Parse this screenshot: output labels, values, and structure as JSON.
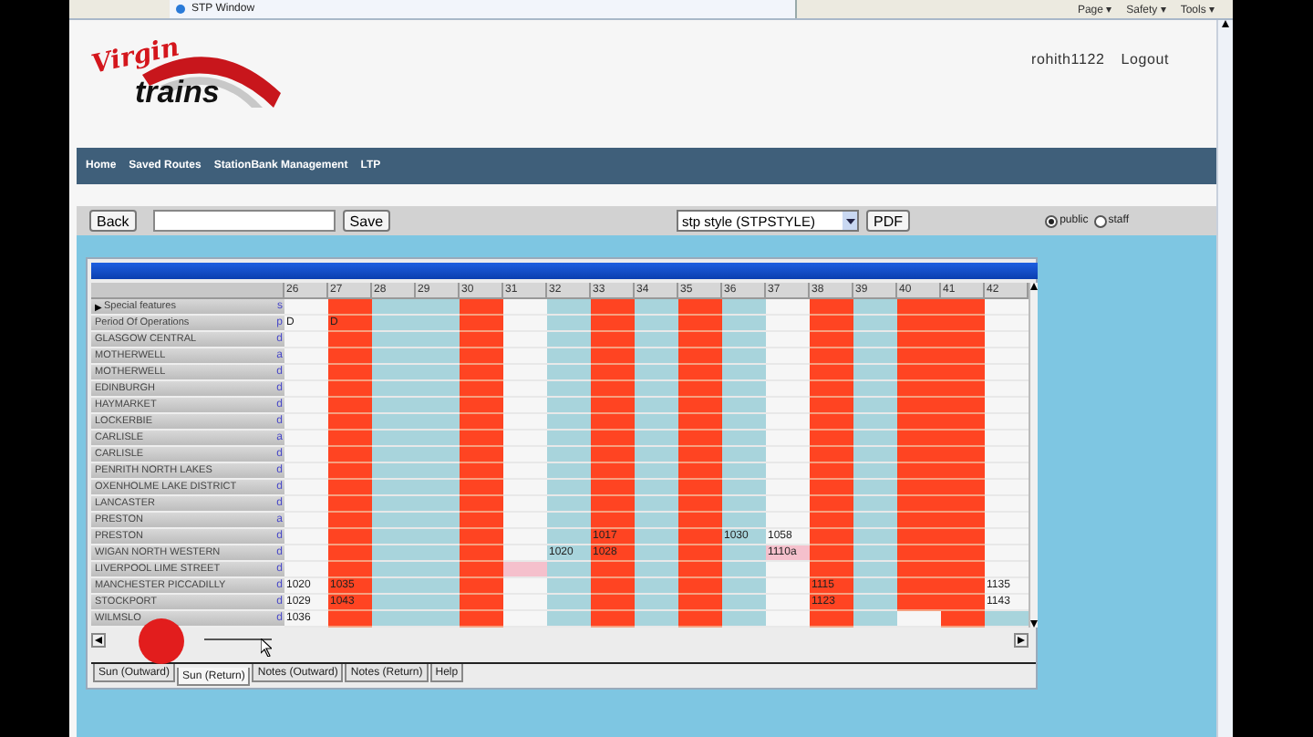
{
  "browser": {
    "tab_title": "STP Window",
    "menus": [
      "Page ▾",
      "Safety ▾",
      "Tools ▾"
    ]
  },
  "logo": {
    "line1": "Virgin",
    "line2": "trains"
  },
  "user": {
    "name": "rohith1122",
    "logout": "Logout"
  },
  "nav": [
    "Home",
    "Saved Routes",
    "StationBank Management",
    "LTP"
  ],
  "toolbar": {
    "back": "Back",
    "save": "Save",
    "style_select": "stp style (STPSTYLE)",
    "pdf": "PDF",
    "radios": [
      {
        "label": "public",
        "selected": true
      },
      {
        "label": "staff",
        "selected": false
      }
    ]
  },
  "grid": {
    "columns": [
      "26",
      "27",
      "28",
      "29",
      "30",
      "31",
      "32",
      "33",
      "34",
      "35",
      "36",
      "37",
      "38",
      "39",
      "40",
      "41",
      "42"
    ],
    "rows": [
      {
        "label": "Special features",
        "expander": "▶",
        "flag": "s",
        "cells": [
          {
            "kind": "white"
          },
          {
            "kind": "red"
          },
          {
            "kind": "blue"
          },
          {
            "kind": "blue"
          },
          {
            "kind": "red"
          },
          {
            "kind": "white"
          },
          {
            "kind": "blue"
          },
          {
            "kind": "red"
          },
          {
            "kind": "blue"
          },
          {
            "kind": "red"
          },
          {
            "kind": "blue"
          },
          {
            "kind": "white"
          },
          {
            "kind": "red"
          },
          {
            "kind": "blue"
          },
          {
            "kind": "red"
          },
          {
            "kind": "red"
          },
          {
            "kind": "white"
          }
        ]
      },
      {
        "label": "Period Of Operations",
        "flag": "p",
        "cells": [
          {
            "kind": "white",
            "text": "D"
          },
          {
            "kind": "red",
            "text": "D"
          },
          {
            "kind": "blue"
          },
          {
            "kind": "blue"
          },
          {
            "kind": "red"
          },
          {
            "kind": "white"
          },
          {
            "kind": "blue"
          },
          {
            "kind": "red"
          },
          {
            "kind": "blue"
          },
          {
            "kind": "red"
          },
          {
            "kind": "blue"
          },
          {
            "kind": "white"
          },
          {
            "kind": "red"
          },
          {
            "kind": "blue"
          },
          {
            "kind": "red"
          },
          {
            "kind": "red"
          },
          {
            "kind": "white"
          }
        ]
      },
      {
        "label": "GLASGOW CENTRAL",
        "flag": "d",
        "cells": [
          {
            "kind": "white"
          },
          {
            "kind": "red"
          },
          {
            "kind": "blue"
          },
          {
            "kind": "blue"
          },
          {
            "kind": "red"
          },
          {
            "kind": "white"
          },
          {
            "kind": "blue"
          },
          {
            "kind": "red"
          },
          {
            "kind": "blue"
          },
          {
            "kind": "red"
          },
          {
            "kind": "blue"
          },
          {
            "kind": "white"
          },
          {
            "kind": "red"
          },
          {
            "kind": "blue"
          },
          {
            "kind": "red"
          },
          {
            "kind": "red"
          },
          {
            "kind": "white"
          }
        ]
      },
      {
        "label": "MOTHERWELL",
        "flag": "a",
        "cells": [
          {
            "kind": "white"
          },
          {
            "kind": "red"
          },
          {
            "kind": "blue"
          },
          {
            "kind": "blue"
          },
          {
            "kind": "red"
          },
          {
            "kind": "white"
          },
          {
            "kind": "blue"
          },
          {
            "kind": "red"
          },
          {
            "kind": "blue"
          },
          {
            "kind": "red"
          },
          {
            "kind": "blue"
          },
          {
            "kind": "white"
          },
          {
            "kind": "red"
          },
          {
            "kind": "blue"
          },
          {
            "kind": "red"
          },
          {
            "kind": "red"
          },
          {
            "kind": "white"
          }
        ]
      },
      {
        "label": "MOTHERWELL",
        "flag": "d",
        "cells": [
          {
            "kind": "white"
          },
          {
            "kind": "red"
          },
          {
            "kind": "blue"
          },
          {
            "kind": "blue"
          },
          {
            "kind": "red"
          },
          {
            "kind": "white"
          },
          {
            "kind": "blue"
          },
          {
            "kind": "red"
          },
          {
            "kind": "blue"
          },
          {
            "kind": "red"
          },
          {
            "kind": "blue"
          },
          {
            "kind": "white"
          },
          {
            "kind": "red"
          },
          {
            "kind": "blue"
          },
          {
            "kind": "red"
          },
          {
            "kind": "red"
          },
          {
            "kind": "white"
          }
        ]
      },
      {
        "label": "EDINBURGH",
        "flag": "d",
        "cells": [
          {
            "kind": "white"
          },
          {
            "kind": "red"
          },
          {
            "kind": "blue"
          },
          {
            "kind": "blue"
          },
          {
            "kind": "red"
          },
          {
            "kind": "white"
          },
          {
            "kind": "blue"
          },
          {
            "kind": "red"
          },
          {
            "kind": "blue"
          },
          {
            "kind": "red"
          },
          {
            "kind": "blue"
          },
          {
            "kind": "white"
          },
          {
            "kind": "red"
          },
          {
            "kind": "blue"
          },
          {
            "kind": "red"
          },
          {
            "kind": "red"
          },
          {
            "kind": "white"
          }
        ]
      },
      {
        "label": "HAYMARKET",
        "flag": "d",
        "cells": [
          {
            "kind": "white"
          },
          {
            "kind": "red"
          },
          {
            "kind": "blue"
          },
          {
            "kind": "blue"
          },
          {
            "kind": "red"
          },
          {
            "kind": "white"
          },
          {
            "kind": "blue"
          },
          {
            "kind": "red"
          },
          {
            "kind": "blue"
          },
          {
            "kind": "red"
          },
          {
            "kind": "blue"
          },
          {
            "kind": "white"
          },
          {
            "kind": "red"
          },
          {
            "kind": "blue"
          },
          {
            "kind": "red"
          },
          {
            "kind": "red"
          },
          {
            "kind": "white"
          }
        ]
      },
      {
        "label": "LOCKERBIE",
        "flag": "d",
        "cells": [
          {
            "kind": "white"
          },
          {
            "kind": "red"
          },
          {
            "kind": "blue"
          },
          {
            "kind": "blue"
          },
          {
            "kind": "red"
          },
          {
            "kind": "white"
          },
          {
            "kind": "blue"
          },
          {
            "kind": "red"
          },
          {
            "kind": "blue"
          },
          {
            "kind": "red"
          },
          {
            "kind": "blue"
          },
          {
            "kind": "white"
          },
          {
            "kind": "red"
          },
          {
            "kind": "blue"
          },
          {
            "kind": "red"
          },
          {
            "kind": "red"
          },
          {
            "kind": "white"
          }
        ]
      },
      {
        "label": "CARLISLE",
        "flag": "a",
        "cells": [
          {
            "kind": "white"
          },
          {
            "kind": "red"
          },
          {
            "kind": "blue"
          },
          {
            "kind": "blue"
          },
          {
            "kind": "red"
          },
          {
            "kind": "white"
          },
          {
            "kind": "blue"
          },
          {
            "kind": "red"
          },
          {
            "kind": "blue"
          },
          {
            "kind": "red"
          },
          {
            "kind": "blue"
          },
          {
            "kind": "white"
          },
          {
            "kind": "red"
          },
          {
            "kind": "blue"
          },
          {
            "kind": "red"
          },
          {
            "kind": "red"
          },
          {
            "kind": "white"
          }
        ]
      },
      {
        "label": "CARLISLE",
        "flag": "d",
        "cells": [
          {
            "kind": "white"
          },
          {
            "kind": "red"
          },
          {
            "kind": "blue"
          },
          {
            "kind": "blue"
          },
          {
            "kind": "red"
          },
          {
            "kind": "white"
          },
          {
            "kind": "blue"
          },
          {
            "kind": "red"
          },
          {
            "kind": "blue"
          },
          {
            "kind": "red"
          },
          {
            "kind": "blue"
          },
          {
            "kind": "white"
          },
          {
            "kind": "red"
          },
          {
            "kind": "blue"
          },
          {
            "kind": "red"
          },
          {
            "kind": "red"
          },
          {
            "kind": "white"
          }
        ]
      },
      {
        "label": "PENRITH NORTH LAKES",
        "flag": "d",
        "cells": [
          {
            "kind": "white"
          },
          {
            "kind": "red"
          },
          {
            "kind": "blue"
          },
          {
            "kind": "blue"
          },
          {
            "kind": "red"
          },
          {
            "kind": "white"
          },
          {
            "kind": "blue"
          },
          {
            "kind": "red"
          },
          {
            "kind": "blue"
          },
          {
            "kind": "red"
          },
          {
            "kind": "blue"
          },
          {
            "kind": "white"
          },
          {
            "kind": "red"
          },
          {
            "kind": "blue"
          },
          {
            "kind": "red"
          },
          {
            "kind": "red"
          },
          {
            "kind": "white"
          }
        ]
      },
      {
        "label": "OXENHOLME LAKE DISTRICT",
        "flag": "d",
        "cells": [
          {
            "kind": "white"
          },
          {
            "kind": "red"
          },
          {
            "kind": "blue"
          },
          {
            "kind": "blue"
          },
          {
            "kind": "red"
          },
          {
            "kind": "white"
          },
          {
            "kind": "blue"
          },
          {
            "kind": "red"
          },
          {
            "kind": "blue"
          },
          {
            "kind": "red"
          },
          {
            "kind": "blue"
          },
          {
            "kind": "white"
          },
          {
            "kind": "red"
          },
          {
            "kind": "blue"
          },
          {
            "kind": "red"
          },
          {
            "kind": "red"
          },
          {
            "kind": "white"
          }
        ]
      },
      {
        "label": "LANCASTER",
        "flag": "d",
        "cells": [
          {
            "kind": "white"
          },
          {
            "kind": "red"
          },
          {
            "kind": "blue"
          },
          {
            "kind": "blue"
          },
          {
            "kind": "red"
          },
          {
            "kind": "white"
          },
          {
            "kind": "blue"
          },
          {
            "kind": "red"
          },
          {
            "kind": "blue"
          },
          {
            "kind": "red"
          },
          {
            "kind": "blue"
          },
          {
            "kind": "white"
          },
          {
            "kind": "red"
          },
          {
            "kind": "blue"
          },
          {
            "kind": "red"
          },
          {
            "kind": "red"
          },
          {
            "kind": "white"
          }
        ]
      },
      {
        "label": "PRESTON",
        "flag": "a",
        "cells": [
          {
            "kind": "white"
          },
          {
            "kind": "red"
          },
          {
            "kind": "blue"
          },
          {
            "kind": "blue"
          },
          {
            "kind": "red"
          },
          {
            "kind": "white"
          },
          {
            "kind": "blue"
          },
          {
            "kind": "red"
          },
          {
            "kind": "blue"
          },
          {
            "kind": "red"
          },
          {
            "kind": "blue"
          },
          {
            "kind": "white"
          },
          {
            "kind": "red"
          },
          {
            "kind": "blue"
          },
          {
            "kind": "red"
          },
          {
            "kind": "red"
          },
          {
            "kind": "white"
          }
        ]
      },
      {
        "label": "PRESTON",
        "flag": "d",
        "cells": [
          {
            "kind": "white"
          },
          {
            "kind": "red"
          },
          {
            "kind": "blue"
          },
          {
            "kind": "blue"
          },
          {
            "kind": "red"
          },
          {
            "kind": "white"
          },
          {
            "kind": "blue"
          },
          {
            "kind": "red",
            "text": "1017"
          },
          {
            "kind": "blue"
          },
          {
            "kind": "red"
          },
          {
            "kind": "blue",
            "text": "1030"
          },
          {
            "kind": "white",
            "text": "1058"
          },
          {
            "kind": "red"
          },
          {
            "kind": "blue"
          },
          {
            "kind": "red"
          },
          {
            "kind": "red"
          },
          {
            "kind": "white"
          }
        ]
      },
      {
        "label": "WIGAN NORTH WESTERN",
        "flag": "d",
        "cells": [
          {
            "kind": "white"
          },
          {
            "kind": "red"
          },
          {
            "kind": "blue"
          },
          {
            "kind": "blue"
          },
          {
            "kind": "red"
          },
          {
            "kind": "white"
          },
          {
            "kind": "blue",
            "text": "1020"
          },
          {
            "kind": "red",
            "text": "1028"
          },
          {
            "kind": "blue"
          },
          {
            "kind": "red"
          },
          {
            "kind": "blue"
          },
          {
            "kind": "pink",
            "text": "1110a"
          },
          {
            "kind": "red"
          },
          {
            "kind": "blue"
          },
          {
            "kind": "red"
          },
          {
            "kind": "red"
          },
          {
            "kind": "white"
          }
        ]
      },
      {
        "label": "LIVERPOOL LIME STREET",
        "flag": "d",
        "cells": [
          {
            "kind": "white"
          },
          {
            "kind": "red"
          },
          {
            "kind": "blue"
          },
          {
            "kind": "blue"
          },
          {
            "kind": "red"
          },
          {
            "kind": "pink"
          },
          {
            "kind": "blue"
          },
          {
            "kind": "red"
          },
          {
            "kind": "blue"
          },
          {
            "kind": "red"
          },
          {
            "kind": "blue"
          },
          {
            "kind": "white"
          },
          {
            "kind": "red"
          },
          {
            "kind": "blue"
          },
          {
            "kind": "red"
          },
          {
            "kind": "red"
          },
          {
            "kind": "white"
          }
        ]
      },
      {
        "label": "MANCHESTER PICCADILLY",
        "flag": "d",
        "cells": [
          {
            "kind": "white",
            "text": "1020"
          },
          {
            "kind": "red",
            "text": "1035"
          },
          {
            "kind": "blue"
          },
          {
            "kind": "blue"
          },
          {
            "kind": "red"
          },
          {
            "kind": "white"
          },
          {
            "kind": "blue"
          },
          {
            "kind": "red"
          },
          {
            "kind": "blue"
          },
          {
            "kind": "red"
          },
          {
            "kind": "blue"
          },
          {
            "kind": "white"
          },
          {
            "kind": "red",
            "text": "1115"
          },
          {
            "kind": "blue"
          },
          {
            "kind": "red"
          },
          {
            "kind": "red"
          },
          {
            "kind": "white",
            "text": "1135"
          }
        ]
      },
      {
        "label": "STOCKPORT",
        "flag": "d",
        "cells": [
          {
            "kind": "white",
            "text": "1029"
          },
          {
            "kind": "red",
            "text": "1043"
          },
          {
            "kind": "blue"
          },
          {
            "kind": "blue"
          },
          {
            "kind": "red"
          },
          {
            "kind": "white"
          },
          {
            "kind": "blue"
          },
          {
            "kind": "red"
          },
          {
            "kind": "blue"
          },
          {
            "kind": "red"
          },
          {
            "kind": "blue"
          },
          {
            "kind": "white"
          },
          {
            "kind": "red",
            "text": "1123"
          },
          {
            "kind": "blue"
          },
          {
            "kind": "red"
          },
          {
            "kind": "red"
          },
          {
            "kind": "white",
            "text": "1143"
          }
        ]
      },
      {
        "label": "WILMSLO",
        "flag": "d",
        "cells": [
          {
            "kind": "white",
            "text": "1036"
          },
          {
            "kind": "red"
          },
          {
            "kind": "blue"
          },
          {
            "kind": "blue"
          },
          {
            "kind": "red"
          },
          {
            "kind": "white"
          },
          {
            "kind": "blue"
          },
          {
            "kind": "red"
          },
          {
            "kind": "blue"
          },
          {
            "kind": "red"
          },
          {
            "kind": "blue"
          },
          {
            "kind": "white"
          },
          {
            "kind": "red"
          },
          {
            "kind": "blue"
          },
          {
            "kind": "white"
          },
          {
            "kind": "red"
          },
          {
            "kind": "blue"
          }
        ]
      }
    ]
  },
  "tabs": [
    {
      "label": "Sun (Outward)",
      "selected": false
    },
    {
      "label": "Sun (Return)",
      "selected": true
    },
    {
      "label": "Notes (Outward)",
      "selected": false
    },
    {
      "label": "Notes (Return)",
      "selected": false
    },
    {
      "label": "Help",
      "selected": false
    }
  ]
}
